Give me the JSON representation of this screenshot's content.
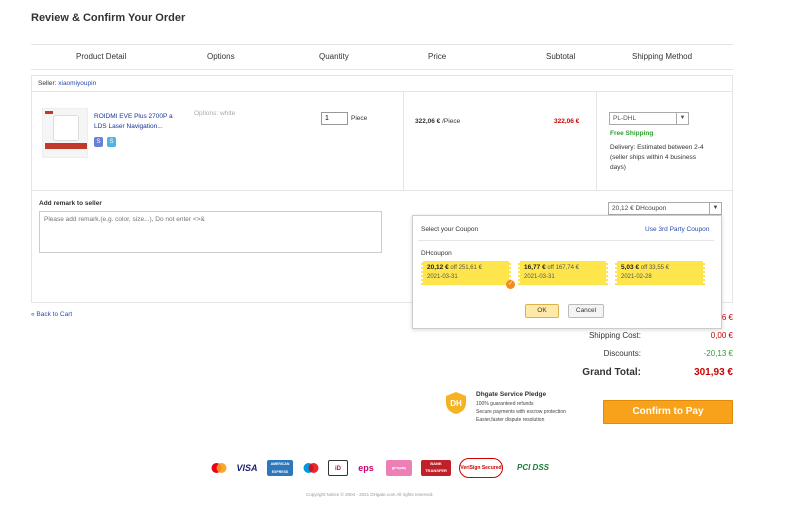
{
  "page_title": "Review & Confirm Your Order",
  "table_headers": {
    "product_detail": "Product Detail",
    "options": "Options",
    "quantity": "Quantity",
    "price": "Price",
    "subtotal": "Subtotal",
    "shipping_method": "Shipping Method"
  },
  "seller": {
    "label": "Seller:",
    "name": "xiaomiyoupin"
  },
  "product": {
    "name": "ROIDMI EVE Plus 2700P a LDS Laser Navigation...",
    "options": "Options:  white",
    "quantity": "1",
    "unit": "Piece",
    "price": "322,06 €",
    "price_unit": " /Piece",
    "subtotal": "322,06 €",
    "badges": [
      "S",
      "S"
    ]
  },
  "shipping": {
    "method": "PL-DHL",
    "free": "Free Shipping",
    "delivery": "Delivery: Estimated between 2-4 (seller ships within 4 business days)"
  },
  "remark": {
    "label": "Add remark to seller",
    "placeholder": "Please add remark.(e.g. color, size...), Do not enter <>&"
  },
  "coupon_select": "20,12 € DHcoupon",
  "coupon_panel": {
    "title": "Select your Coupon",
    "third_party": "Use 3rd Party Coupon",
    "group": "DHcoupon",
    "coupons": [
      {
        "amount": "20,12 €",
        "off": " off 251,61 €",
        "date": "2021-03-31",
        "selected": true
      },
      {
        "amount": "16,77 €",
        "off": " off 167,74 €",
        "date": "2021-03-31",
        "selected": false
      },
      {
        "amount": "5,03 €",
        "off": " off 33,55 €",
        "date": "2021-02-28",
        "selected": false
      }
    ],
    "ok": "OK",
    "cancel": "Cancel"
  },
  "back_link": "« Back to Cart",
  "summary": {
    "subtotal_partial": "6 €",
    "shipping_label": "Shipping Cost:",
    "shipping_value": "0,00 €",
    "discounts_label": "Discounts:",
    "discounts_value": "-20,13 €",
    "grand_label": "Grand Total:",
    "grand_value": "301,93 €"
  },
  "pledge": {
    "title": "Dhgate Service Pledge",
    "lines": [
      "100% guaranteed refunds",
      "Secure payments with escrow protection",
      "Easier,faster dispute resolution"
    ],
    "icon_text": "DH"
  },
  "confirm_button": "Confirm to Pay",
  "payment_logos": {
    "mastercard": "",
    "visa": "VISA",
    "amex": "AMERICAN EXPRESS",
    "maestro": "",
    "ideal": "iD",
    "eps": "eps",
    "giropay": "giropay",
    "bank": "BANK TRANSFER",
    "verisign": "VeriSign Secured",
    "pci": "PCI DSS"
  },
  "copyright": "Copyright Notice © 2004 - 2021 DHgate.com All rights reserved.",
  "colors": {
    "link": "#2a4bb2",
    "price_red": "#cc0000",
    "free_green": "#2ea12e",
    "confirm_orange": "#f8a21c",
    "coupon_yellow": "#ffe54c"
  }
}
